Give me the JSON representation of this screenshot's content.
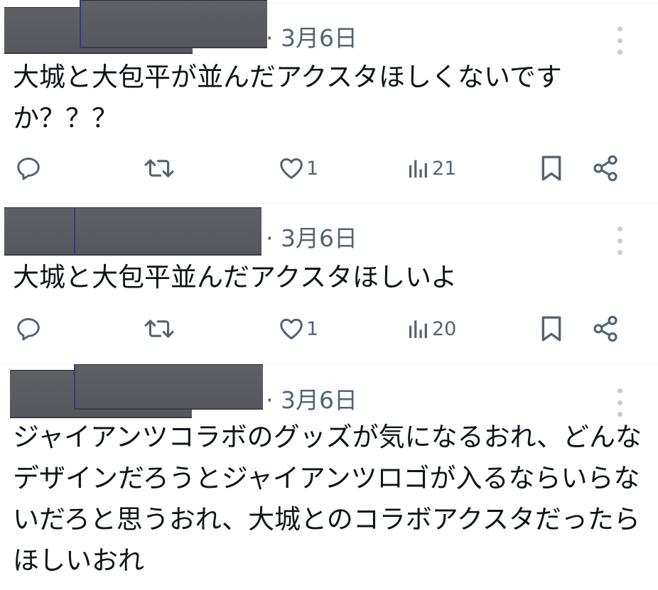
{
  "tweets": [
    {
      "date": "· 3月6日",
      "text": "大城と大包平が並んだアクスタほしくないですか？？？",
      "likes": "1",
      "views": "21"
    },
    {
      "date": "· 3月6日",
      "text": "大城と大包平並んだアクスタほしいよ",
      "likes": "1",
      "views": "20"
    },
    {
      "date": "· 3月6日",
      "text": "ジャイアンツコラボのグッズが気になるおれ、どんなデザインだろうとジャイアンツロゴが入るならいらないだろと思うおれ、大城とのコラボアクスタだったらほしいおれ"
    }
  ],
  "icons": {
    "reply": "reply-icon",
    "retweet": "retweet-icon",
    "like": "heart-icon",
    "views": "analytics-icon",
    "bookmark": "bookmark-icon",
    "share": "share-icon",
    "more": "more-icon"
  },
  "colors": {
    "text": "#0f1419",
    "secondary": "#536471",
    "divider": "#eff3f4",
    "redaction": "#5a5b61"
  }
}
